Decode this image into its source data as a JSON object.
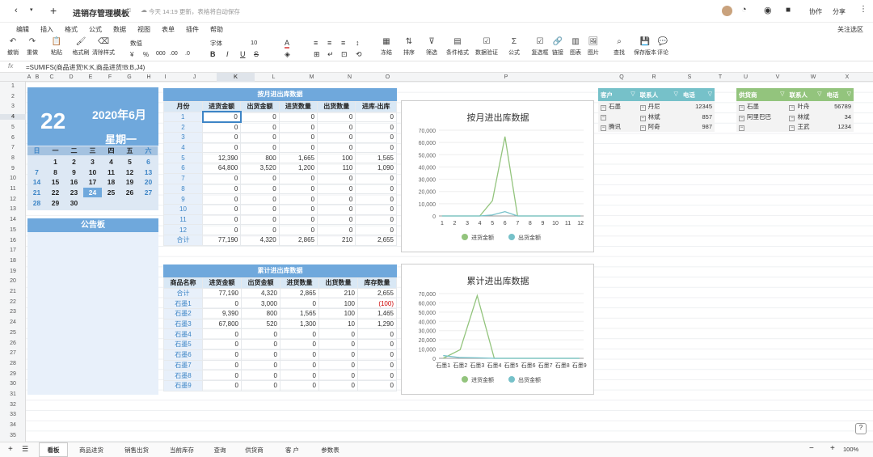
{
  "app": {
    "title": "进销存管理模板",
    "status": "今天 14:19 更新，表格将自动保存",
    "collab": "协作",
    "share": "分享"
  },
  "menu": [
    "编辑",
    "插入",
    "格式",
    "公式",
    "数据",
    "视图",
    "表单",
    "插件",
    "帮助"
  ],
  "menu_right": "关注选区",
  "toolbar": [
    {
      "icon": "undo-icon",
      "glyph": "↶",
      "label": "撤销"
    },
    {
      "icon": "redo-icon",
      "glyph": "↷",
      "label": "重做"
    },
    {
      "icon": "paste-icon",
      "glyph": "📋",
      "label": "粘贴"
    },
    {
      "icon": "format-painter-icon",
      "glyph": "🖌",
      "label": "格式刷"
    },
    {
      "icon": "clear-format-icon",
      "glyph": "⌫",
      "label": "清除样式"
    },
    {
      "icon": "freeze-icon",
      "glyph": "▦",
      "label": "冻结"
    },
    {
      "icon": "sort-icon",
      "glyph": "⇅",
      "label": "排序"
    },
    {
      "icon": "filter-icon",
      "glyph": "⊽",
      "label": "筛选"
    },
    {
      "icon": "conditional-format-icon",
      "glyph": "▤",
      "label": "条件格式"
    },
    {
      "icon": "data-validation-icon",
      "glyph": "☑",
      "label": "数据验证"
    },
    {
      "icon": "formula-icon",
      "glyph": "Σ",
      "label": "公式"
    },
    {
      "icon": "checkbox-icon",
      "glyph": "☑",
      "label": "复选框"
    },
    {
      "icon": "link-icon",
      "glyph": "🔗",
      "label": "链接"
    },
    {
      "icon": "chart-icon",
      "glyph": "▥",
      "label": "图表"
    },
    {
      "icon": "image-icon",
      "glyph": "🖼",
      "label": "图片"
    },
    {
      "icon": "find-icon",
      "glyph": "⌕",
      "label": "查找"
    },
    {
      "icon": "save-version-icon",
      "glyph": "💾",
      "label": "保存版本"
    },
    {
      "icon": "comment-icon",
      "glyph": "💬",
      "label": "评论"
    }
  ],
  "toolbar_fmt": {
    "number": "数值",
    "currency": "¥",
    "percent": "%",
    "thousands": "000",
    "dec1": ".00",
    "dec2": ".0",
    "font": "字体",
    "size": "10"
  },
  "formula": "=SUMIFS(商品进货!K:K,商品进货!B:B,J4)",
  "cols": [
    "A",
    "B",
    "C",
    "D",
    "E",
    "F",
    "G",
    "H",
    "I",
    "J",
    "K",
    "L",
    "M",
    "N",
    "O",
    "P",
    "Q",
    "R",
    "S",
    "T",
    "U",
    "V",
    "W",
    "X"
  ],
  "rows": [
    "1",
    "2",
    "3",
    "4",
    "5",
    "6",
    "7",
    "8",
    "9",
    "10",
    "11",
    "12",
    "13",
    "14",
    "15",
    "16",
    "17",
    "18",
    "19",
    "20",
    "21",
    "22",
    "23",
    "24",
    "25",
    "26",
    "27",
    "28",
    "29",
    "30",
    "31",
    "32",
    "33",
    "34",
    "35"
  ],
  "calendar": {
    "day": "22",
    "month": "2020年6月",
    "weekday": "星期一",
    "weekdays": [
      "日",
      "一",
      "二",
      "三",
      "四",
      "五",
      "六"
    ],
    "weeks": [
      [
        "",
        "1",
        "2",
        "3",
        "4",
        "5",
        "6"
      ],
      [
        "7",
        "8",
        "9",
        "10",
        "11",
        "12",
        "13"
      ],
      [
        "14",
        "15",
        "16",
        "17",
        "18",
        "19",
        "20"
      ],
      [
        "21",
        "22",
        "23",
        "24",
        "25",
        "26",
        "27"
      ],
      [
        "28",
        "29",
        "30",
        "",
        "",
        "",
        ""
      ]
    ],
    "today": "24"
  },
  "notice": "公告板",
  "monthly": {
    "title": "按月进出库数据",
    "headers": [
      "月份",
      "进货金额",
      "出货金额",
      "进货数量",
      "出货数量",
      "进库-出库"
    ],
    "rows": [
      [
        "1",
        "0",
        "0",
        "0",
        "0",
        "0"
      ],
      [
        "2",
        "0",
        "0",
        "0",
        "0",
        "0"
      ],
      [
        "3",
        "0",
        "0",
        "0",
        "0",
        "0"
      ],
      [
        "4",
        "0",
        "0",
        "0",
        "0",
        "0"
      ],
      [
        "5",
        "12,390",
        "800",
        "1,665",
        "100",
        "1,565"
      ],
      [
        "6",
        "64,800",
        "3,520",
        "1,200",
        "110",
        "1,090"
      ],
      [
        "7",
        "0",
        "0",
        "0",
        "0",
        "0"
      ],
      [
        "8",
        "0",
        "0",
        "0",
        "0",
        "0"
      ],
      [
        "9",
        "0",
        "0",
        "0",
        "0",
        "0"
      ],
      [
        "10",
        "0",
        "0",
        "0",
        "0",
        "0"
      ],
      [
        "11",
        "0",
        "0",
        "0",
        "0",
        "0"
      ],
      [
        "12",
        "0",
        "0",
        "0",
        "0",
        "0"
      ],
      [
        "合计",
        "77,190",
        "4,320",
        "2,865",
        "210",
        "2,655"
      ]
    ]
  },
  "cumulative": {
    "title": "累计进出库数据",
    "headers": [
      "商品名称",
      "进货金额",
      "出货金额",
      "进货数量",
      "出货数量",
      "库存数量"
    ],
    "rows": [
      [
        "合计",
        "77,190",
        "4,320",
        "2,865",
        "210",
        "2,655"
      ],
      [
        "石墨1",
        "0",
        "3,000",
        "0",
        "100",
        "(100)"
      ],
      [
        "石墨2",
        "9,390",
        "800",
        "1,565",
        "100",
        "1,465"
      ],
      [
        "石墨3",
        "67,800",
        "520",
        "1,300",
        "10",
        "1,290"
      ],
      [
        "石墨4",
        "0",
        "0",
        "0",
        "0",
        "0"
      ],
      [
        "石墨5",
        "0",
        "0",
        "0",
        "0",
        "0"
      ],
      [
        "石墨6",
        "0",
        "0",
        "0",
        "0",
        "0"
      ],
      [
        "石墨7",
        "0",
        "0",
        "0",
        "0",
        "0"
      ],
      [
        "石墨8",
        "0",
        "0",
        "0",
        "0",
        "0"
      ],
      [
        "石墨9",
        "0",
        "0",
        "0",
        "0",
        "0"
      ]
    ]
  },
  "customers": {
    "headers": [
      "客户",
      "联系人",
      "电话"
    ],
    "rows": [
      [
        "石墨",
        "丹尼",
        "12345"
      ],
      [
        "",
        "林斌",
        "857"
      ],
      [
        "腾讯",
        "阿奇",
        "987"
      ]
    ]
  },
  "suppliers": {
    "headers": [
      "供货商",
      "联系人",
      "电话"
    ],
    "rows": [
      [
        "石墨",
        "叶舟",
        "56789"
      ],
      [
        "阿里巴巴",
        "林斌",
        "34"
      ],
      [
        "",
        "王武",
        "1234"
      ]
    ]
  },
  "chart_data": [
    {
      "type": "line",
      "title": "按月进出库数据",
      "categories": [
        "1",
        "2",
        "3",
        "4",
        "5",
        "6",
        "7",
        "8",
        "9",
        "10",
        "11",
        "12"
      ],
      "series": [
        {
          "name": "进货金额",
          "values": [
            0,
            0,
            0,
            0,
            12390,
            64800,
            0,
            0,
            0,
            0,
            0,
            0
          ],
          "color": "#93c47d"
        },
        {
          "name": "出货金额",
          "values": [
            0,
            0,
            0,
            0,
            800,
            3520,
            0,
            0,
            0,
            0,
            0,
            0
          ],
          "color": "#76c1c9"
        }
      ],
      "ylim": [
        0,
        70000
      ],
      "yticks": [
        "0",
        "10,000",
        "20,000",
        "30,000",
        "40,000",
        "50,000",
        "60,000",
        "70,000"
      ],
      "legend": "bottom"
    },
    {
      "type": "line",
      "title": "累计进出库数据",
      "categories": [
        "石墨1",
        "石墨2",
        "石墨3",
        "石墨4",
        "石墨5",
        "石墨6",
        "石墨7",
        "石墨8",
        "石墨9"
      ],
      "series": [
        {
          "name": "进货金额",
          "values": [
            0,
            9390,
            67800,
            0,
            0,
            0,
            0,
            0,
            0
          ],
          "color": "#93c47d"
        },
        {
          "name": "出货金额",
          "values": [
            3000,
            800,
            520,
            0,
            0,
            0,
            0,
            0,
            0
          ],
          "color": "#76c1c9"
        }
      ],
      "ylim": [
        0,
        70000
      ],
      "yticks": [
        "0",
        "10,000",
        "20,000",
        "30,000",
        "40,000",
        "50,000",
        "60,000",
        "70,000"
      ],
      "legend": "bottom"
    }
  ],
  "tabs": [
    "看板",
    "商品进货",
    "销售出货",
    "当前库存",
    "查询",
    "供货商",
    "客 户",
    "参数表"
  ],
  "zoom": "100%"
}
